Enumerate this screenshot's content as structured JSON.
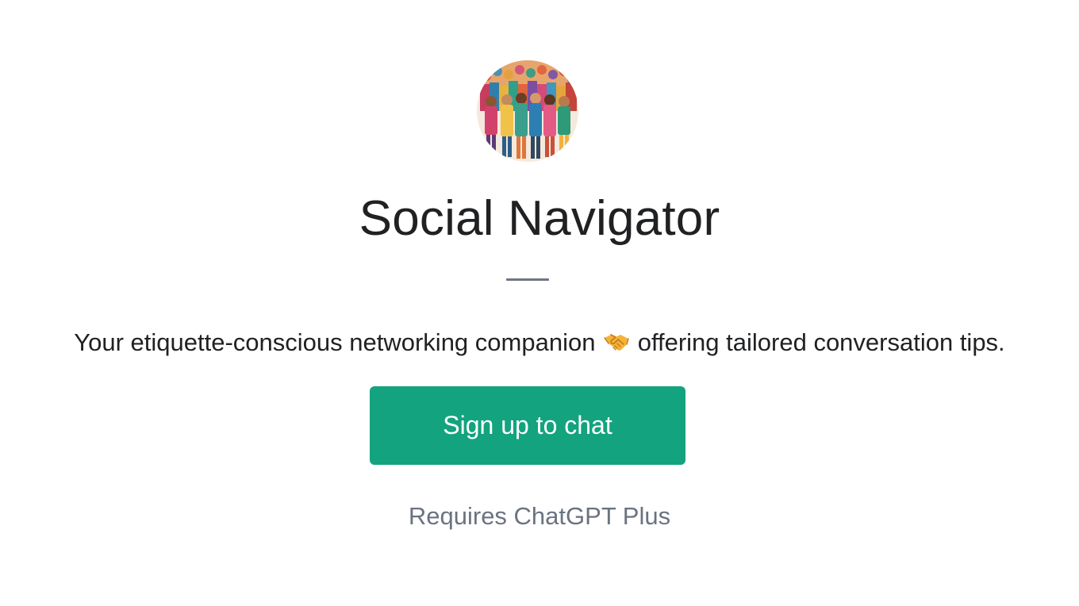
{
  "gpt": {
    "avatar_icon": "crowd-illustration-icon",
    "name": "Social Navigator",
    "description_before": "Your etiquette-conscious networking companion",
    "description_emoji": "handshake-icon",
    "description_after": "offering tailored conversation tips."
  },
  "actions": {
    "signup_label": "Sign up to chat"
  },
  "footer": {
    "requirement": "Requires ChatGPT Plus"
  },
  "colors": {
    "accent": "#13a37f",
    "title": "#202123",
    "muted": "#6b7380",
    "divider": "#6e7681"
  }
}
